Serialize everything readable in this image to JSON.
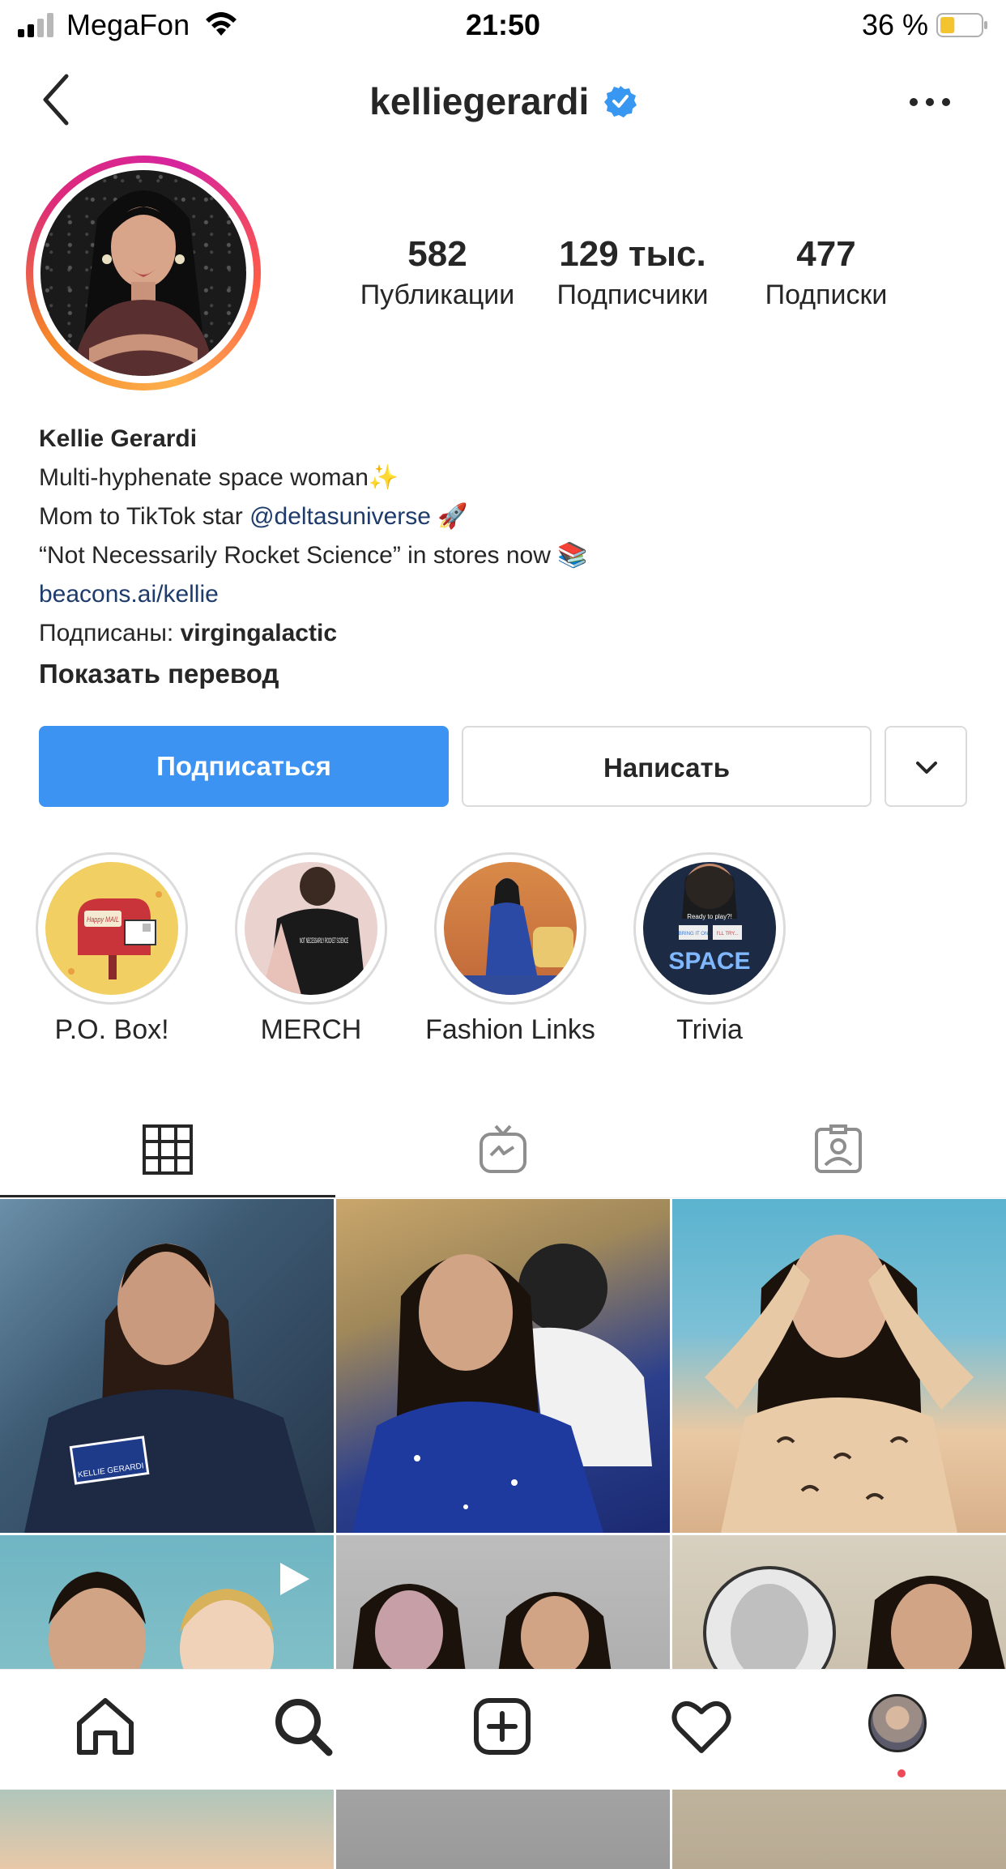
{
  "status_bar": {
    "carrier": "MegaFon",
    "time": "21:50",
    "battery_percent": "36 %",
    "battery_level": 0.36,
    "battery_color": "#f4c430"
  },
  "header": {
    "username": "kelliegerardi",
    "verified": true,
    "back_icon": "chevron-left-icon",
    "more_icon": "more-horizontal-icon"
  },
  "profile": {
    "stats": [
      {
        "value": "582",
        "label": "Публикации"
      },
      {
        "value": "129 тыс.",
        "label": "Подписчики"
      },
      {
        "value": "477",
        "label": "Подписки"
      }
    ],
    "name": "Kellie Gerardi",
    "bio_line1": "Multi-hyphenate space woman✨",
    "bio_line2_prefix": "Mom to TikTok star ",
    "bio_line2_mention": "@deltasuniverse",
    "bio_line2_suffix": " 🚀",
    "bio_line3": "“Not Necessarily Rocket Science” in stores now 📚",
    "website": "beacons.ai/kellie",
    "followed_by_prefix": "Подписаны: ",
    "followed_by_user": "virgingalactic",
    "show_translation": "Показать перевод"
  },
  "actions": {
    "follow_label": "Подписаться",
    "message_label": "Написать",
    "follow_color": "#3d93f1"
  },
  "highlights": [
    {
      "label": "P.O. Box!"
    },
    {
      "label": "MERCH"
    },
    {
      "label": "Fashion Links"
    },
    {
      "label": "Trivia"
    }
  ],
  "highlight_texts": {
    "mail_tag": "Happy MAIL",
    "merch_shirt": "NOT NECESSARILY ROCKET SCIENCE",
    "trivia_banner": "Ready to play?!",
    "trivia_left": "BRING IT ON",
    "trivia_right": "I'LL TRY...",
    "trivia_space": "SPACE"
  },
  "tabs": [
    {
      "icon": "grid-icon",
      "active": true
    },
    {
      "icon": "igtv-icon",
      "active": false
    },
    {
      "icon": "tagged-icon",
      "active": false
    }
  ],
  "posts": {
    "patch_text": "KELLIE GERARDI",
    "video_icon": "play-icon"
  },
  "bottom_nav": [
    {
      "icon": "home-icon"
    },
    {
      "icon": "search-icon"
    },
    {
      "icon": "add-post-icon"
    },
    {
      "icon": "heart-icon"
    },
    {
      "icon": "profile-avatar"
    }
  ]
}
